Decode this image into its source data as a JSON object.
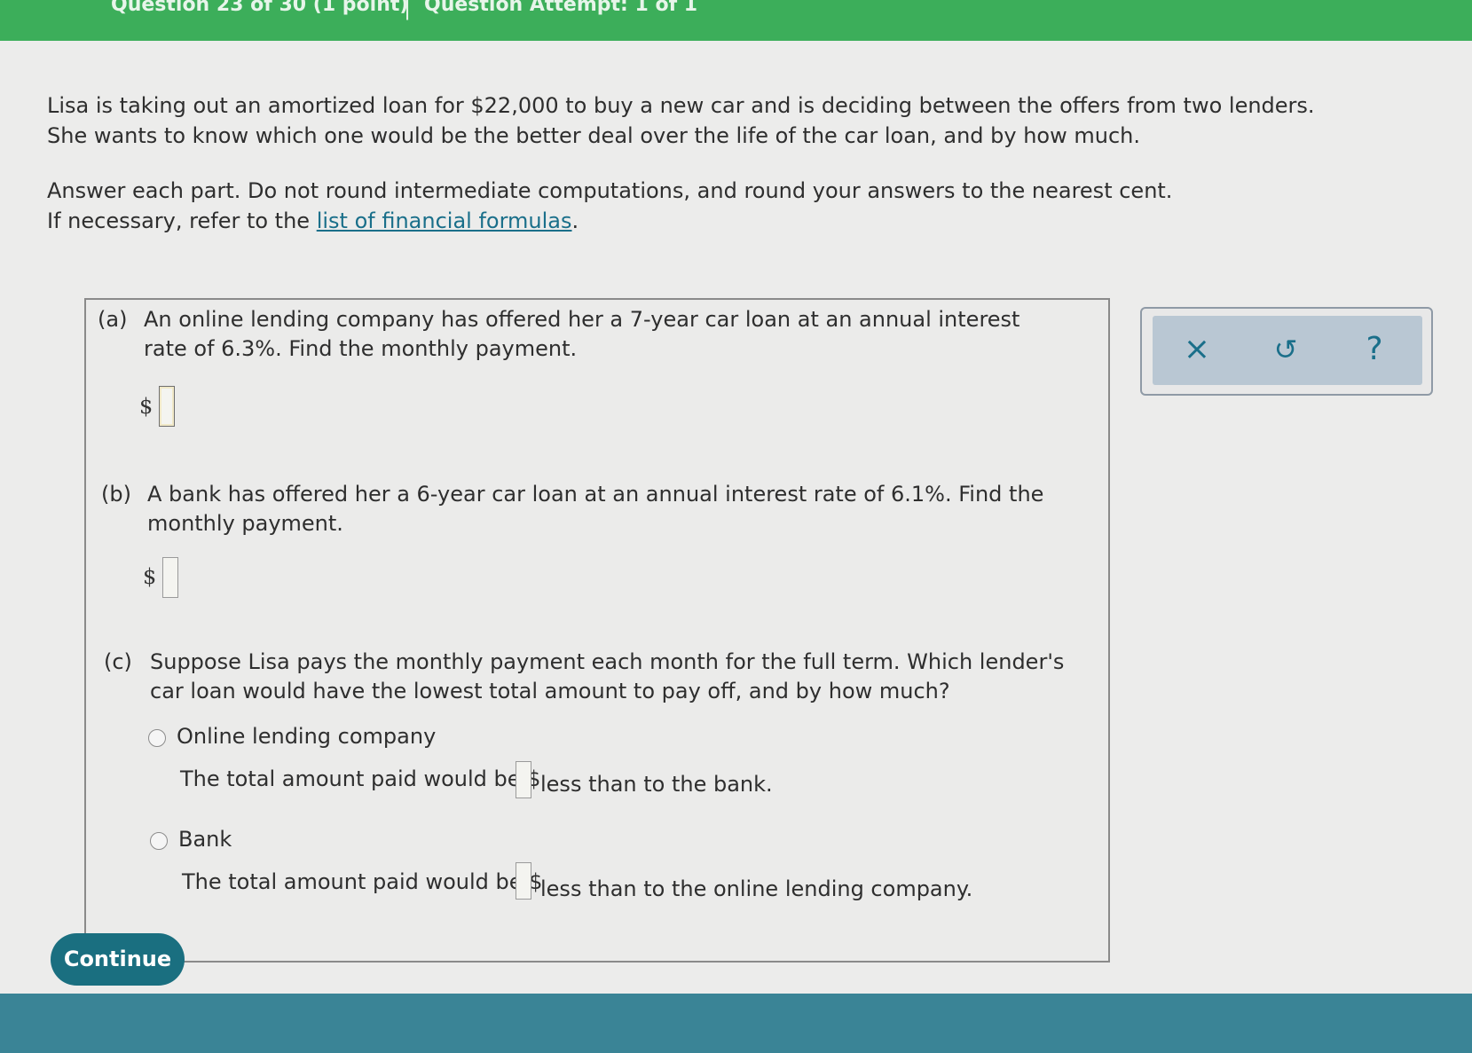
{
  "header": {
    "question_info": "Question 23 of 30 (1 point)",
    "separator": "|",
    "attempt_info": "Question Attempt: 1 of 1"
  },
  "intro": {
    "line1": "Lisa is taking out an amortized loan for $22,000 to buy a new car and is deciding between the offers from two lenders.",
    "line2": "She wants to know which one would be the better deal over the life of the car loan, and by how much.",
    "instructions1": "Answer each part. Do not round intermediate computations, and round your answers to the nearest cent.",
    "instructions2_prefix": "If necessary, refer to the ",
    "formulas_link": "list of financial formulas",
    "instructions2_suffix": "."
  },
  "part_a": {
    "label": "(a)",
    "text": "An online lending company has offered her a 7-year car loan at an annual interest rate of 6.3%. Find the monthly payment.",
    "currency": "$"
  },
  "part_b": {
    "label": "(b)",
    "text": "A bank has offered her a 6-year car loan at an annual interest rate of 6.1%. Find the monthly payment.",
    "currency": "$"
  },
  "part_c": {
    "label": "(c)",
    "text": "Suppose Lisa pays the monthly payment each month for the full term. Which lender's car loan would have the lowest total amount to pay off, and by how much?",
    "option1_label": "Online lending company",
    "option1_sentence_prefix": "The total amount paid would be $",
    "option1_sentence_suffix": "less than to the bank.",
    "option2_label": "Bank",
    "option2_sentence_prefix": "The total amount paid would be $",
    "option2_sentence_suffix": "less than to the online lending company."
  },
  "tools": {
    "clear_glyph": "×",
    "undo_glyph": "↺",
    "help_glyph": "?"
  },
  "continue_label": "Continue"
}
